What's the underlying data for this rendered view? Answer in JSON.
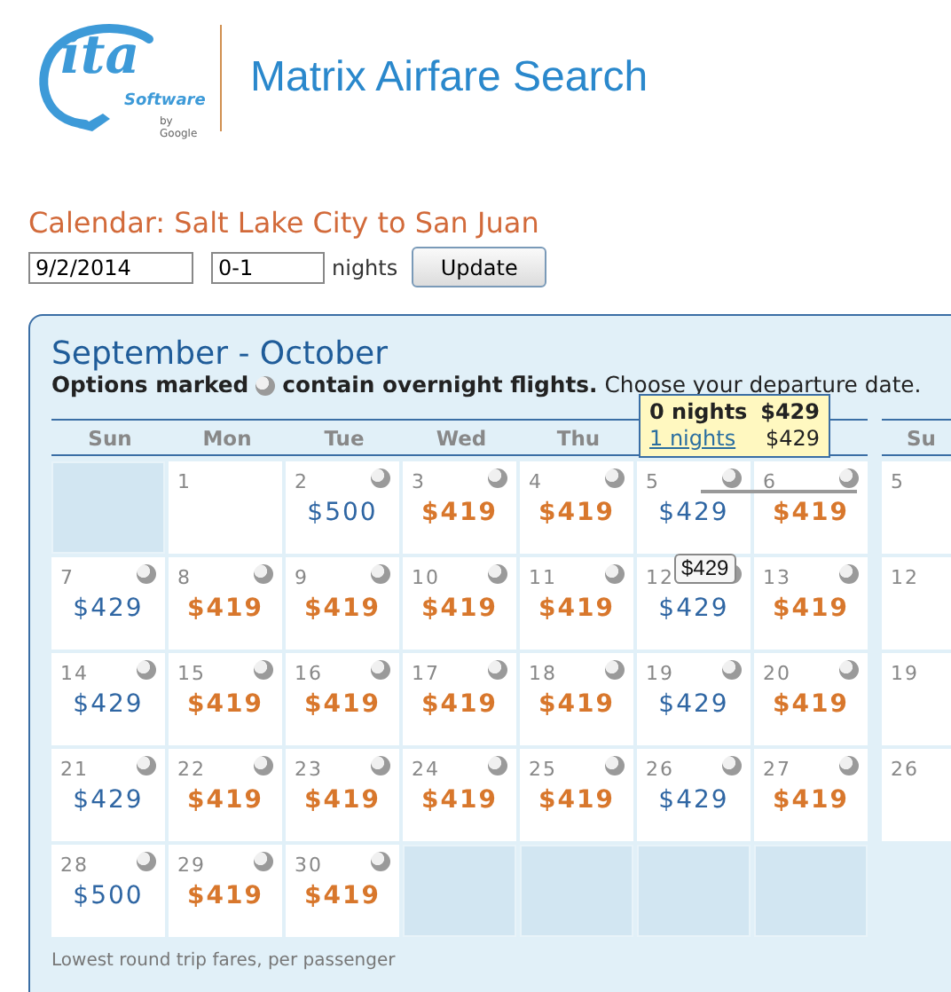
{
  "logo": {
    "main": "ita",
    "sub": "Software",
    "byline": "by Google"
  },
  "app_title": "Matrix Airfare Search",
  "heading": "Calendar: Salt Lake City to San Juan",
  "form": {
    "date": "9/2/2014",
    "nights": "0-1",
    "nights_label": "nights",
    "button": "Update"
  },
  "calendar": {
    "title": "September - October",
    "legend_bold": "Options marked",
    "legend_bold_2": "contain overnight flights.",
    "legend_rest": "Choose your departure date.",
    "weekdays": [
      "Sun",
      "Mon",
      "Tue",
      "Wed",
      "Thu"
    ],
    "weeks": [
      [
        {
          "kind": "blank"
        },
        {
          "kind": "day",
          "day": "1",
          "overnight": false
        },
        {
          "kind": "day",
          "day": "2",
          "price": "$500",
          "lowest": false,
          "overnight": true
        },
        {
          "kind": "day",
          "day": "3",
          "price": "$419",
          "lowest": true,
          "overnight": true
        },
        {
          "kind": "day",
          "day": "4",
          "price": "$419",
          "lowest": true,
          "overnight": true
        },
        {
          "kind": "day",
          "day": "5",
          "price": "$429",
          "lowest": false,
          "overnight": true,
          "in_range": true
        },
        {
          "kind": "day",
          "day": "6",
          "price": "$419",
          "lowest": true,
          "overnight": true,
          "in_range": true
        }
      ],
      [
        {
          "kind": "day",
          "day": "7",
          "price": "$429",
          "lowest": false,
          "overnight": true
        },
        {
          "kind": "day",
          "day": "8",
          "price": "$419",
          "lowest": true,
          "overnight": true
        },
        {
          "kind": "day",
          "day": "9",
          "price": "$419",
          "lowest": true,
          "overnight": true
        },
        {
          "kind": "day",
          "day": "10",
          "price": "$419",
          "lowest": true,
          "overnight": true
        },
        {
          "kind": "day",
          "day": "11",
          "price": "$419",
          "lowest": true,
          "overnight": true
        },
        {
          "kind": "day",
          "day": "12",
          "price": "$429",
          "lowest": false,
          "overnight": true
        },
        {
          "kind": "day",
          "day": "13",
          "price": "$419",
          "lowest": true,
          "overnight": true
        }
      ],
      [
        {
          "kind": "day",
          "day": "14",
          "price": "$429",
          "lowest": false,
          "overnight": true
        },
        {
          "kind": "day",
          "day": "15",
          "price": "$419",
          "lowest": true,
          "overnight": true
        },
        {
          "kind": "day",
          "day": "16",
          "price": "$419",
          "lowest": true,
          "overnight": true
        },
        {
          "kind": "day",
          "day": "17",
          "price": "$419",
          "lowest": true,
          "overnight": true
        },
        {
          "kind": "day",
          "day": "18",
          "price": "$419",
          "lowest": true,
          "overnight": true
        },
        {
          "kind": "day",
          "day": "19",
          "price": "$429",
          "lowest": false,
          "overnight": true
        },
        {
          "kind": "day",
          "day": "20",
          "price": "$419",
          "lowest": true,
          "overnight": true
        }
      ],
      [
        {
          "kind": "day",
          "day": "21",
          "price": "$429",
          "lowest": false,
          "overnight": true
        },
        {
          "kind": "day",
          "day": "22",
          "price": "$419",
          "lowest": true,
          "overnight": true
        },
        {
          "kind": "day",
          "day": "23",
          "price": "$419",
          "lowest": true,
          "overnight": true
        },
        {
          "kind": "day",
          "day": "24",
          "price": "$419",
          "lowest": true,
          "overnight": true
        },
        {
          "kind": "day",
          "day": "25",
          "price": "$419",
          "lowest": true,
          "overnight": true
        },
        {
          "kind": "day",
          "day": "26",
          "price": "$429",
          "lowest": false,
          "overnight": true
        },
        {
          "kind": "day",
          "day": "27",
          "price": "$419",
          "lowest": true,
          "overnight": true
        }
      ],
      [
        {
          "kind": "day",
          "day": "28",
          "price": "$500",
          "lowest": false,
          "overnight": true
        },
        {
          "kind": "day",
          "day": "29",
          "price": "$419",
          "lowest": true,
          "overnight": true
        },
        {
          "kind": "day",
          "day": "30",
          "price": "$419",
          "lowest": true,
          "overnight": true
        },
        {
          "kind": "blank"
        },
        {
          "kind": "blank"
        },
        {
          "kind": "blank"
        },
        {
          "kind": "blank"
        }
      ]
    ],
    "next_month": {
      "weekday": "Su",
      "days": [
        "5",
        "12",
        "19",
        "26"
      ]
    },
    "tooltip": {
      "rows": [
        {
          "nights": "0 nights",
          "price": "$429",
          "selected": true
        },
        {
          "nights": "1 nights",
          "price": "$429",
          "selected": false
        }
      ]
    },
    "hover_price": "$429",
    "footer": "Lowest round trip fares, per passenger"
  }
}
